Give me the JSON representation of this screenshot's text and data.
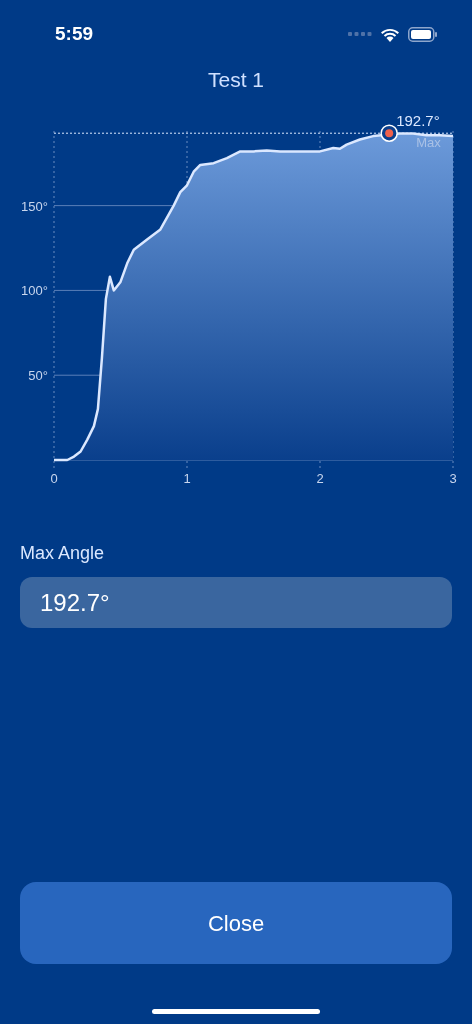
{
  "status_bar": {
    "time": "5:59"
  },
  "title": "Test 1",
  "chart_data": {
    "type": "area",
    "x": [
      0,
      0.1,
      0.15,
      0.2,
      0.25,
      0.3,
      0.33,
      0.36,
      0.39,
      0.42,
      0.45,
      0.5,
      0.55,
      0.6,
      0.7,
      0.8,
      0.9,
      0.95,
      1.0,
      1.05,
      1.1,
      1.2,
      1.3,
      1.4,
      1.5,
      1.6,
      1.7,
      1.8,
      1.9,
      2.0,
      2.1,
      2.15,
      2.2,
      2.3,
      2.4,
      2.6,
      2.7,
      2.8,
      2.9,
      3.0
    ],
    "series": [
      {
        "color": "#dbe8ff",
        "values": [
          0,
          0,
          2,
          5,
          12,
          20,
          30,
          60,
          95,
          108,
          100,
          105,
          116,
          124,
          130,
          136,
          150,
          158,
          162,
          170,
          174,
          175,
          178,
          182,
          182,
          182.5,
          182,
          182,
          182,
          182,
          184,
          183.5,
          186,
          189,
          191,
          192.5,
          192.5,
          191.5,
          191.5,
          191
        ]
      }
    ],
    "grid": true,
    "ref_lines": [
      {
        "axis": "y",
        "value": 192.7
      }
    ],
    "xlim": [
      0,
      3
    ],
    "ylim": [
      0,
      194
    ],
    "xticks": [
      0,
      1,
      2,
      3
    ],
    "yticks": [
      {
        "value": 50,
        "label": "50°"
      },
      {
        "value": 100,
        "label": "100°"
      },
      {
        "value": 150,
        "label": "150°"
      }
    ],
    "annotations": [
      {
        "x": 2.52,
        "y": 192.7,
        "text": "192.7°"
      },
      {
        "x": 2.52,
        "y": 192.7,
        "text": "Max"
      }
    ]
  },
  "max_angle": {
    "label": "Max Angle",
    "value": "192.7°"
  },
  "close_button": "Close"
}
